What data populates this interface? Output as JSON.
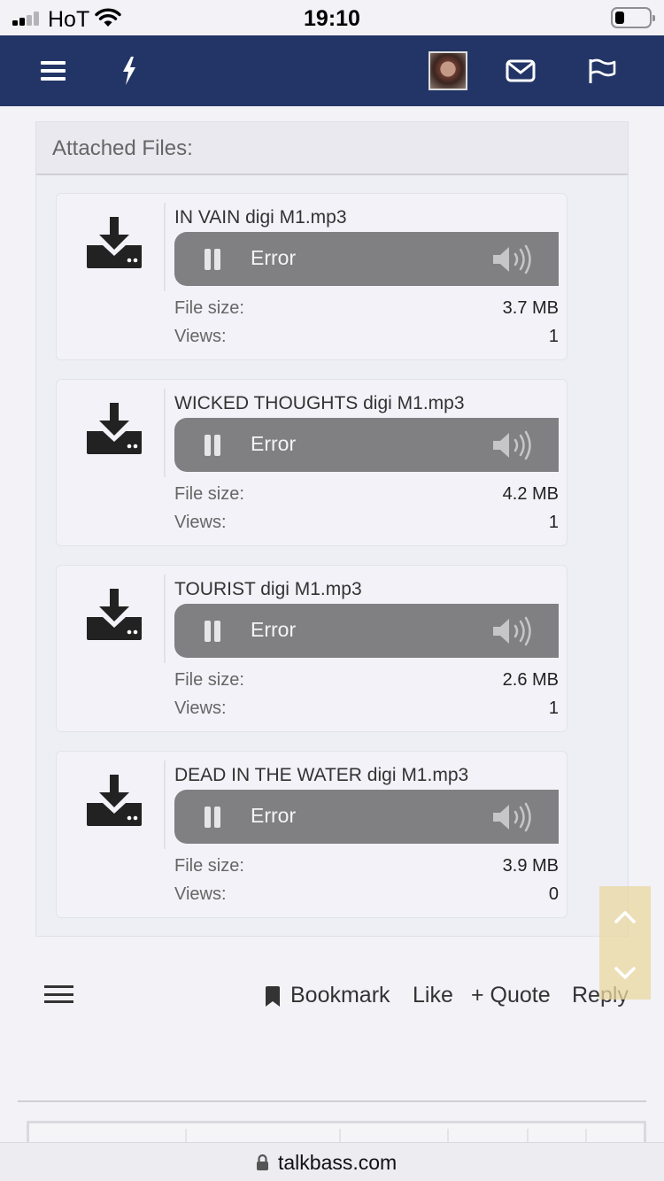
{
  "status_bar": {
    "carrier": "HoT",
    "time": "19:10"
  },
  "navbar": {
    "icons": [
      "menu-icon",
      "bolt-icon",
      "avatar",
      "mail-icon",
      "flag-icon"
    ],
    "background": "#233566"
  },
  "attachments": {
    "heading": "Attached Files:",
    "files": [
      {
        "name": "IN VAIN digi M1.mp3",
        "player_status": "Error",
        "size_label": "File size:",
        "size": "3.7 MB",
        "views_label": "Views:",
        "views": "1"
      },
      {
        "name": "WICKED THOUGHTS digi M1.mp3",
        "player_status": "Error",
        "size_label": "File size:",
        "size": "4.2 MB",
        "views_label": "Views:",
        "views": "1"
      },
      {
        "name": "TOURIST digi M1.mp3",
        "player_status": "Error",
        "size_label": "File size:",
        "size": "2.6 MB",
        "views_label": "Views:",
        "views": "1"
      },
      {
        "name": "DEAD IN THE WATER digi M1.mp3",
        "player_status": "Error",
        "size_label": "File size:",
        "size": "3.9 MB",
        "views_label": "Views:",
        "views": "0"
      }
    ]
  },
  "post_actions": {
    "bookmark": "Bookmark",
    "like": "Like",
    "quote": "+ Quote",
    "reply": "Reply"
  },
  "url_bar": {
    "domain": "talkbass.com"
  }
}
